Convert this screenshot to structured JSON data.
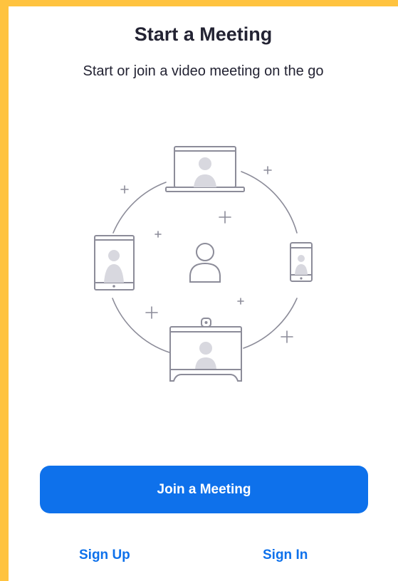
{
  "header": {
    "title": "Start a Meeting",
    "subtitle": "Start or join a video meeting on the go"
  },
  "illustration": {
    "description_icon": "devices-meeting-illustration"
  },
  "actions": {
    "join_label": "Join a Meeting",
    "sign_up_label": "Sign Up",
    "sign_in_label": "Sign In"
  },
  "colors": {
    "accent": "#0E71EB",
    "border": "#FFC33F",
    "text": "#232333",
    "line": "#8C8C99",
    "person": "#D8D8DF"
  }
}
